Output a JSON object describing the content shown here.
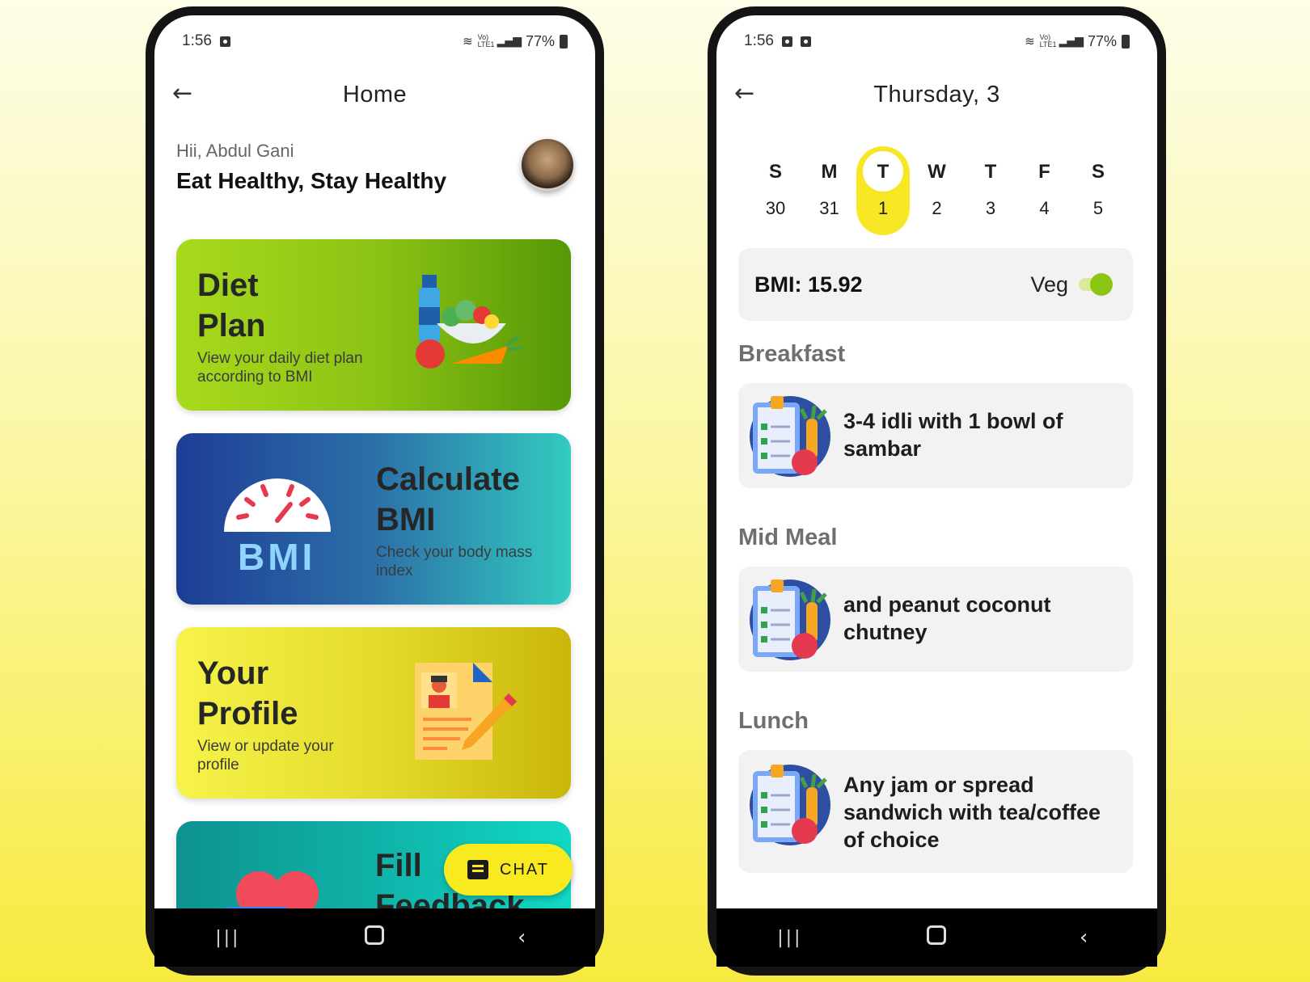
{
  "left_phone": {
    "status": {
      "time": "1:56",
      "net": "Vo) LTE1",
      "battery": "77%"
    },
    "title": "Home",
    "greeting": "Hii, Abdul Gani",
    "tagline": "Eat Healthy, Stay Healthy",
    "cards": [
      {
        "title_1": "Diet",
        "title_2": "Plan",
        "desc_1": "View your daily diet plan",
        "desc_2": "according to BMI"
      },
      {
        "title_1": "Calculate",
        "title_2": "BMI",
        "desc_1": "Check your body mass",
        "desc_2": "index",
        "badge": "BMI"
      },
      {
        "title_1": "Your",
        "title_2": "Profile",
        "desc_1": "View or update your",
        "desc_2": "profile"
      },
      {
        "title_1": "Fill",
        "title_2": "Feedback"
      }
    ],
    "chat_label": "CHAT"
  },
  "right_phone": {
    "status": {
      "time": "1:56",
      "net": "Vo) LTE1",
      "battery": "77%"
    },
    "title": "Thursday, 3",
    "week": [
      {
        "day": "S",
        "date": "30"
      },
      {
        "day": "M",
        "date": "31"
      },
      {
        "day": "T",
        "date": "1"
      },
      {
        "day": "W",
        "date": "2"
      },
      {
        "day": "T",
        "date": "3"
      },
      {
        "day": "F",
        "date": "4"
      },
      {
        "day": "S",
        "date": "5"
      }
    ],
    "bmi_label": "BMI: 15.92",
    "veg_label": "Veg",
    "veg_enabled": true,
    "sections": [
      {
        "heading": "Breakfast",
        "line_1": "3-4 idli with 1 bowl of",
        "line_2": "sambar"
      },
      {
        "heading": "Mid Meal",
        "line_1": "and peanut coconut",
        "line_2": "chutney"
      },
      {
        "heading": "Lunch",
        "line_1": "Any jam or spread",
        "line_2": "sandwich with tea/coffee",
        "line_3": "of choice"
      }
    ]
  },
  "colors": {
    "accent_yellow": "#f8e725",
    "toggle_green": "#8bc614",
    "diet_card": "#8cc315",
    "bmi_card": "#2c6fa8",
    "profile_card": "#e4dc2c",
    "feedback_card": "#10b2a8"
  },
  "icons": {
    "back": "arrow-left-icon",
    "recent_apps": "recent-apps-icon",
    "home": "home-icon",
    "nav_back": "chevron-left-icon",
    "chat": "message-icon"
  }
}
